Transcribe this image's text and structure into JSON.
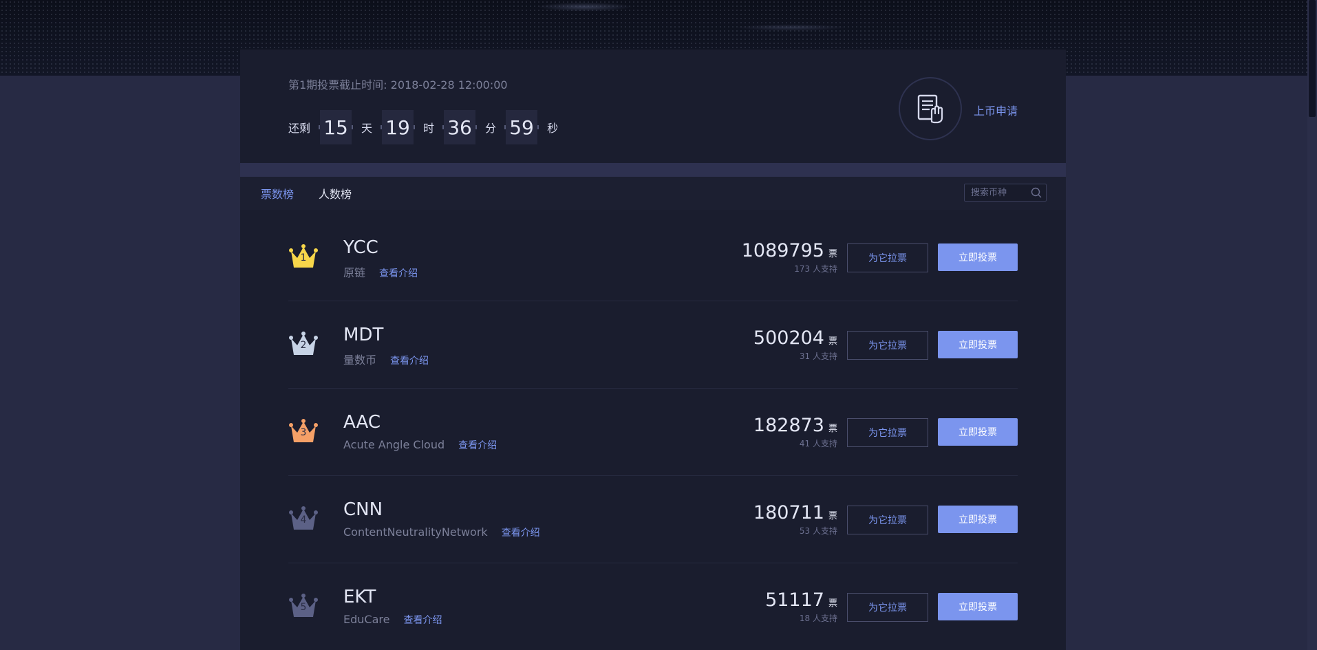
{
  "colors": {
    "accent": "#7b95ee",
    "panel": "#1a1d2e",
    "background": "#272a44",
    "crown_gold": "#f7d64a",
    "crown_silver": "#c7d3e6",
    "crown_bronze": "#f5a067",
    "crown_default": "#5c6186"
  },
  "countdown": {
    "deadline_text": "第1期投票截止时间: 2018-02-28 12:00:00",
    "remaining_label": "还剩",
    "days": "15",
    "days_label": "天",
    "hours": "19",
    "hours_label": "时",
    "minutes": "36",
    "minutes_label": "分",
    "seconds": "59",
    "seconds_label": "秒"
  },
  "listing": {
    "icon": "document-hand-icon",
    "label": "上币申请"
  },
  "tabs": [
    {
      "label": "票数榜",
      "active": true
    },
    {
      "label": "人数榜",
      "active": false
    }
  ],
  "search": {
    "placeholder": "搜索币种",
    "icon": "search-icon"
  },
  "buttons": {
    "canvass_label": "为它拉票",
    "vote_label": "立即投票",
    "intro_label": "查看介绍",
    "vote_unit": "票",
    "supporters_suffix": "人支持"
  },
  "coins": [
    {
      "rank": "1",
      "symbol": "YCC",
      "name": "原链",
      "votes": "1089795",
      "supporters": "173",
      "crown": "crown_gold"
    },
    {
      "rank": "2",
      "symbol": "MDT",
      "name": "量数币",
      "votes": "500204",
      "supporters": "31",
      "crown": "crown_silver"
    },
    {
      "rank": "3",
      "symbol": "AAC",
      "name": "Acute Angle Cloud",
      "votes": "182873",
      "supporters": "41",
      "crown": "crown_bronze"
    },
    {
      "rank": "4",
      "symbol": "CNN",
      "name": "ContentNeutralityNetwork",
      "votes": "180711",
      "supporters": "53",
      "crown": "crown_default"
    },
    {
      "rank": "5",
      "symbol": "EKT",
      "name": "EduCare",
      "votes": "51117",
      "supporters": "18",
      "crown": "crown_default"
    }
  ]
}
